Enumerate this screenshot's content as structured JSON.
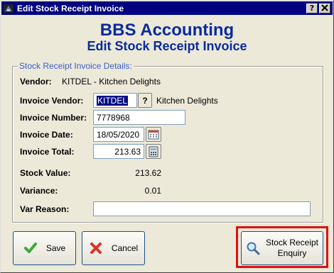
{
  "window": {
    "title": "Edit Stock Receipt Invoice",
    "help_button": "?",
    "close_button": "X"
  },
  "header": {
    "app_name": "BBS Accounting",
    "form_title": "Edit Stock Receipt Invoice"
  },
  "details": {
    "group_label": "Stock Receipt Invoice Details:",
    "vendor_label": "Vendor:",
    "vendor_value": "KITDEL - Kitchen Delights",
    "invoice_vendor_label": "Invoice Vendor:",
    "invoice_vendor_code": "KITDEL",
    "invoice_vendor_lookup": "?",
    "invoice_vendor_name": "Kitchen Delights",
    "invoice_number_label": "Invoice Number:",
    "invoice_number": "7778968",
    "invoice_date_label": "Invoice Date:",
    "invoice_date": "18/05/2020",
    "invoice_total_label": "Invoice Total:",
    "invoice_total": "213.63",
    "stock_value_label": "Stock Value:",
    "stock_value": "213.62",
    "variance_label": "Variance:",
    "variance": "0.01",
    "var_reason_label": "Var Reason:",
    "var_reason": ""
  },
  "buttons": {
    "save": "Save",
    "cancel": "Cancel",
    "enquiry_line1": "Stock Receipt",
    "enquiry_line2": "Enquiry"
  },
  "colors": {
    "titlebar": "#000080",
    "heading": "#0a2a9e",
    "group_label": "#3a5fcd",
    "highlight": "#e01010"
  }
}
